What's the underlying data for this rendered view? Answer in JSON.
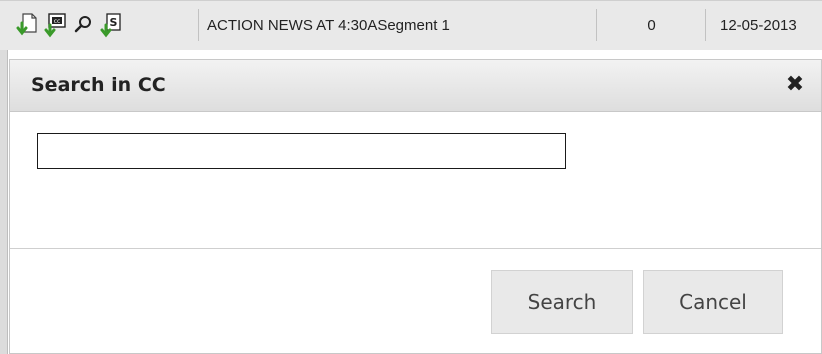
{
  "background_row": {
    "icons": [
      "download-document-icon",
      "download-cc-icon",
      "search-magnifier-icon",
      "download-script-icon"
    ],
    "cc_badge": "cc",
    "script_badge": "S",
    "title": "ACTION NEWS AT 4:30ASegment 1",
    "count": "0",
    "date": "12-05-2013"
  },
  "dialog": {
    "title": "Search in CC",
    "close_symbol": "✖",
    "search_value": "",
    "search_label": "Search",
    "cancel_label": "Cancel"
  },
  "colors": {
    "icon_green": "#3a9a2a",
    "header_bg": "#e6e6e6",
    "button_bg": "#e9e9e9"
  }
}
